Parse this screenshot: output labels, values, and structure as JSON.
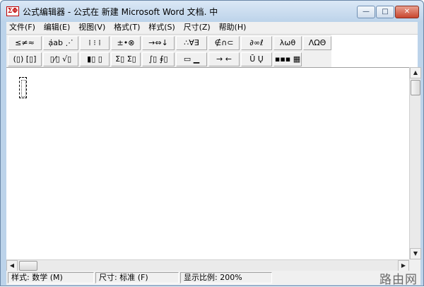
{
  "window": {
    "title": "公式编辑器 - 公式在 新建 Microsoft Word 文档. 中",
    "app_icon_text": "ΣΦ",
    "controls": {
      "minimize": "—",
      "maximize": "□",
      "close": "✕"
    }
  },
  "menubar": {
    "items": [
      {
        "label": "文件(F)"
      },
      {
        "label": "编辑(E)"
      },
      {
        "label": "视图(V)"
      },
      {
        "label": "格式(T)"
      },
      {
        "label": "样式(S)"
      },
      {
        "label": "尺寸(Z)"
      },
      {
        "label": "帮助(H)"
      }
    ]
  },
  "toolbar": {
    "row1": [
      {
        "glyphs": "≤≠≈"
      },
      {
        "glyphs": "ạ̇ab ⋰"
      },
      {
        "glyphs": "⁞ ⁝ ⁞"
      },
      {
        "glyphs": "±•⊗"
      },
      {
        "glyphs": "→⇔↓"
      },
      {
        "glyphs": "∴∀∃"
      },
      {
        "glyphs": "∉∩⊂"
      },
      {
        "glyphs": "∂∞ℓ"
      },
      {
        "glyphs": "λωθ"
      },
      {
        "glyphs": "ΛΩΘ"
      }
    ],
    "row2": [
      {
        "glyphs": "(▯) [▯]"
      },
      {
        "glyphs": "▯⁄▯ √▯"
      },
      {
        "glyphs": "▮▯ ▯"
      },
      {
        "glyphs": "Σ▯ Σ▯"
      },
      {
        "glyphs": "∫▯ ∮▯"
      },
      {
        "glyphs": "▭ ▁"
      },
      {
        "glyphs": "→ ←"
      },
      {
        "glyphs": "Ū Ų"
      },
      {
        "glyphs": "▪▪▪ ▦"
      }
    ]
  },
  "scrollbar": {
    "up": "▲",
    "down": "▼",
    "left": "◀",
    "right": "▶"
  },
  "statusbar": {
    "style": "样式: 数学 (M)",
    "size": "尺寸: 标准 (F)",
    "zoom": "显示比例: 200%"
  },
  "watermark": "路由网"
}
